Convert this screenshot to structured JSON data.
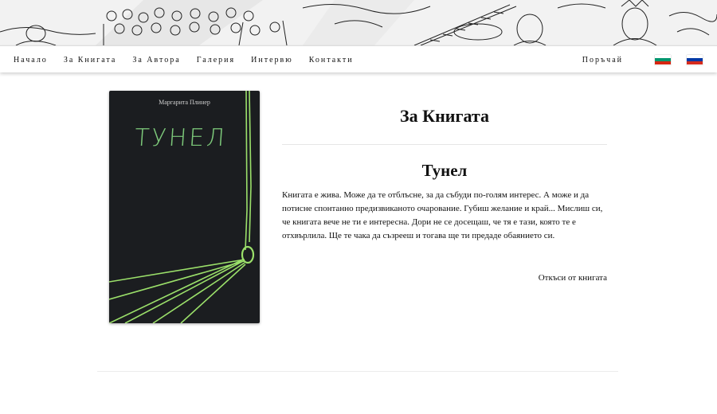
{
  "nav": {
    "items": [
      "Начало",
      "За Книгата",
      "За Автора",
      "Галерия",
      "Интервю",
      "Контакти"
    ],
    "order": "Поръчай",
    "flags": [
      {
        "name": "bulgarian-flag",
        "colors": [
          "#ffffff",
          "#00966e",
          "#d62612"
        ]
      },
      {
        "name": "russian-flag",
        "colors": [
          "#ffffff",
          "#0039a6",
          "#d52b1e"
        ]
      }
    ]
  },
  "book_cover": {
    "author": "Маргарита Плинер",
    "title": "ТУНЕЛ",
    "accent": "#9be06a"
  },
  "content": {
    "section_title": "За Книгата",
    "book_title": "Тунел",
    "description": "Книгата е жива. Може да те отблъсне, за да събуди по-голям интерес. А може и да потисне спонтанно предизвиканото очарование. Губиш желание и край... Мислиш си, че книгата вече не ти е интересна. Дори не се досещаш, че тя е тази, която те е отхвърлила. Ще те чака да съзрееш и тогава ще ти предаде обаянието си.",
    "excerpt_link": "Откъси от книгата"
  }
}
